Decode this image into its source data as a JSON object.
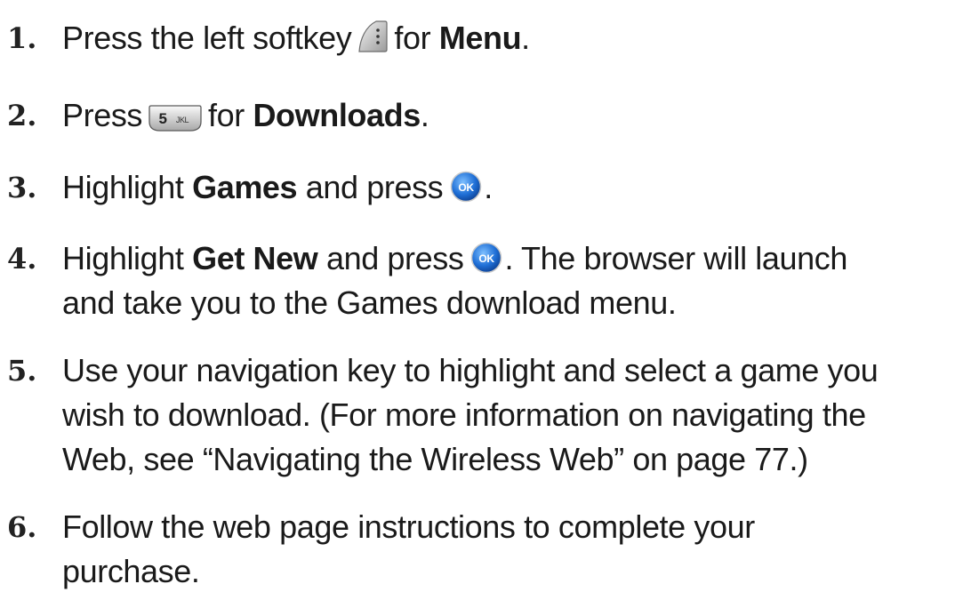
{
  "steps": [
    {
      "num": "1.",
      "pre": "Press the left softkey",
      "icon": "left-softkey-icon",
      "mid": "for",
      "bold": "Menu",
      "post": "."
    },
    {
      "num": "2.",
      "pre": "Press",
      "icon": "key-5-jkl-icon",
      "key_digit": "5",
      "key_letters": "JKL",
      "mid": "for",
      "bold": "Downloads",
      "post": "."
    },
    {
      "num": "3.",
      "pre": "Highlight",
      "bold": "Games",
      "mid": "and press",
      "icon": "ok-button-icon",
      "ok_label": "OK",
      "post": "."
    },
    {
      "num": "4.",
      "pre": "Highlight",
      "bold": "Get New",
      "mid": "and press",
      "icon": "ok-button-icon",
      "ok_label": "OK",
      "post": ". The browser will launch",
      "line2": "and take you to the Games download menu."
    },
    {
      "num": "5.",
      "line1": "Use your navigation key to highlight and select a game you",
      "line2": "wish to download. (For more information on navigating the",
      "line3": "Web, see “Navigating the Wireless Web” on page 77.)"
    },
    {
      "num": "6.",
      "line1": "Follow the web page instructions to complete your",
      "line2": "purchase."
    }
  ]
}
